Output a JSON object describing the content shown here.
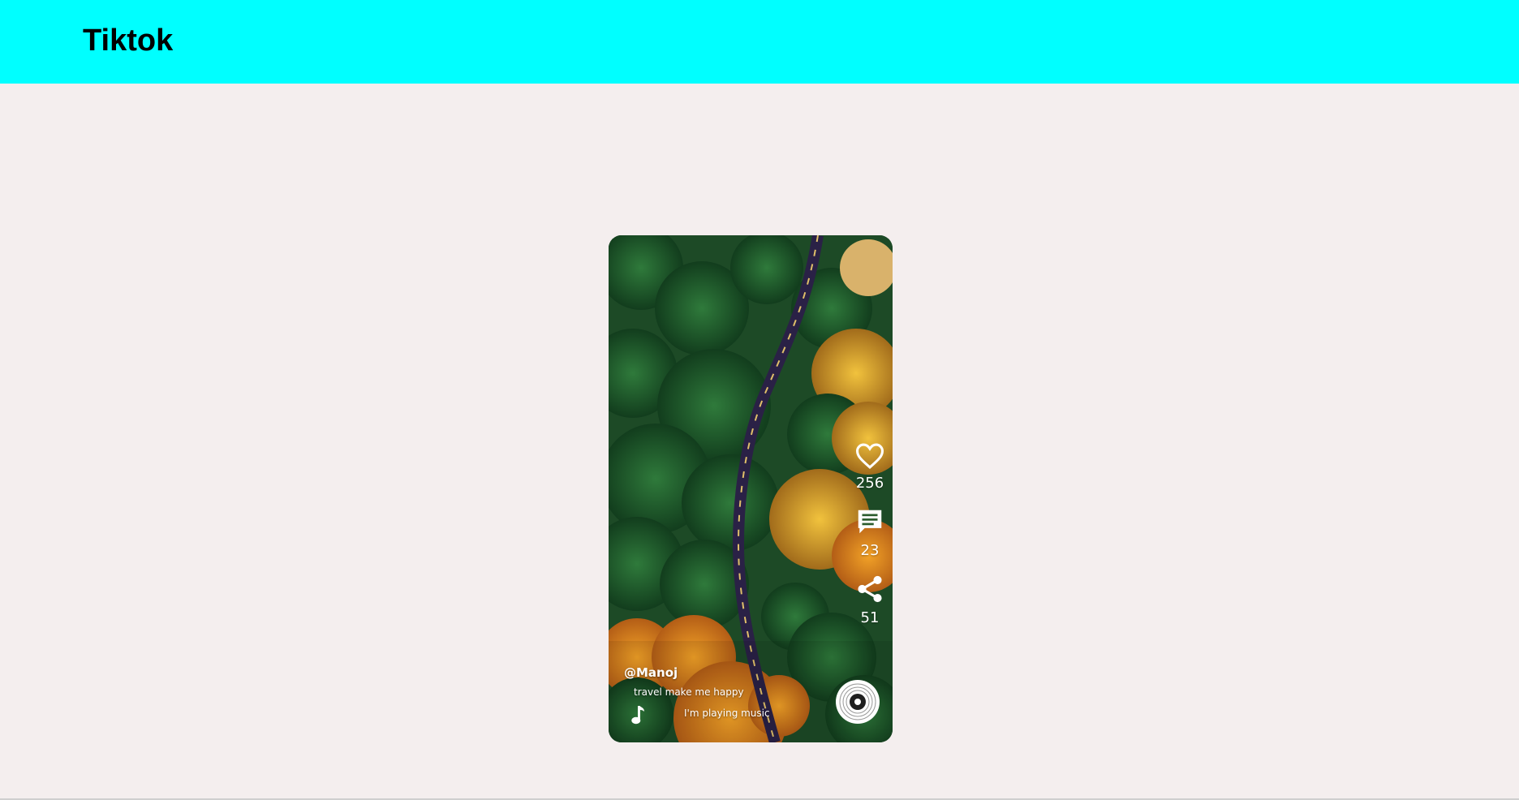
{
  "header": {
    "title": "Tiktok",
    "background_color": "#00ffff"
  },
  "video": {
    "username": "@Manoj",
    "description": "travel make me happy",
    "music": "I'm playing music",
    "likes": "256",
    "comments": "23",
    "shares": "51",
    "icons": [
      "heart-icon",
      "comment-icon",
      "share-icon",
      "music-note-icon",
      "vinyl-record-icon"
    ]
  }
}
